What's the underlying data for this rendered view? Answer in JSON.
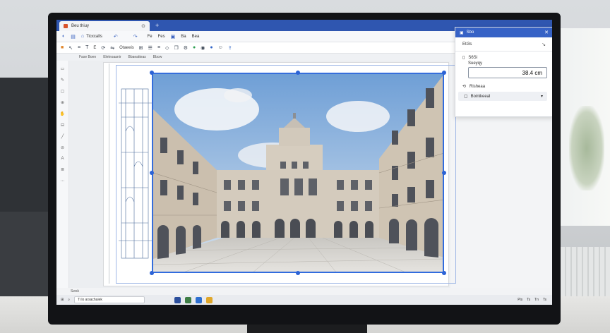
{
  "window": {
    "tab_title": "Beu thiuy",
    "tab_close": "⊙"
  },
  "ribbon": {
    "items": [
      "Ticxcalls",
      "Fe",
      "Fes",
      "Ba",
      "Bea"
    ]
  },
  "toolbar": {
    "label1": "E",
    "label2": "Otaeeis"
  },
  "sheetbar": {
    "items": [
      "Fase Boen",
      "Eletnoaanir",
      "Bbaeatteas",
      "Bbow"
    ]
  },
  "panel": {
    "header": "Sbo",
    "row1": "Eti3s",
    "row2": "S6Sl",
    "row3": "Sueyqy",
    "input_value": "38.4 cm",
    "row4": "Risheaa",
    "select_value": "Boinikeeal"
  },
  "status": {
    "text": "Swsk"
  },
  "taskbar": {
    "search_placeholder": "Ti lo arsachaiek",
    "tray": [
      "Pis",
      "Ts",
      "Tn",
      "Ts"
    ]
  },
  "colors": {
    "accent": "#2f56b0",
    "selection": "#2c63d6"
  }
}
